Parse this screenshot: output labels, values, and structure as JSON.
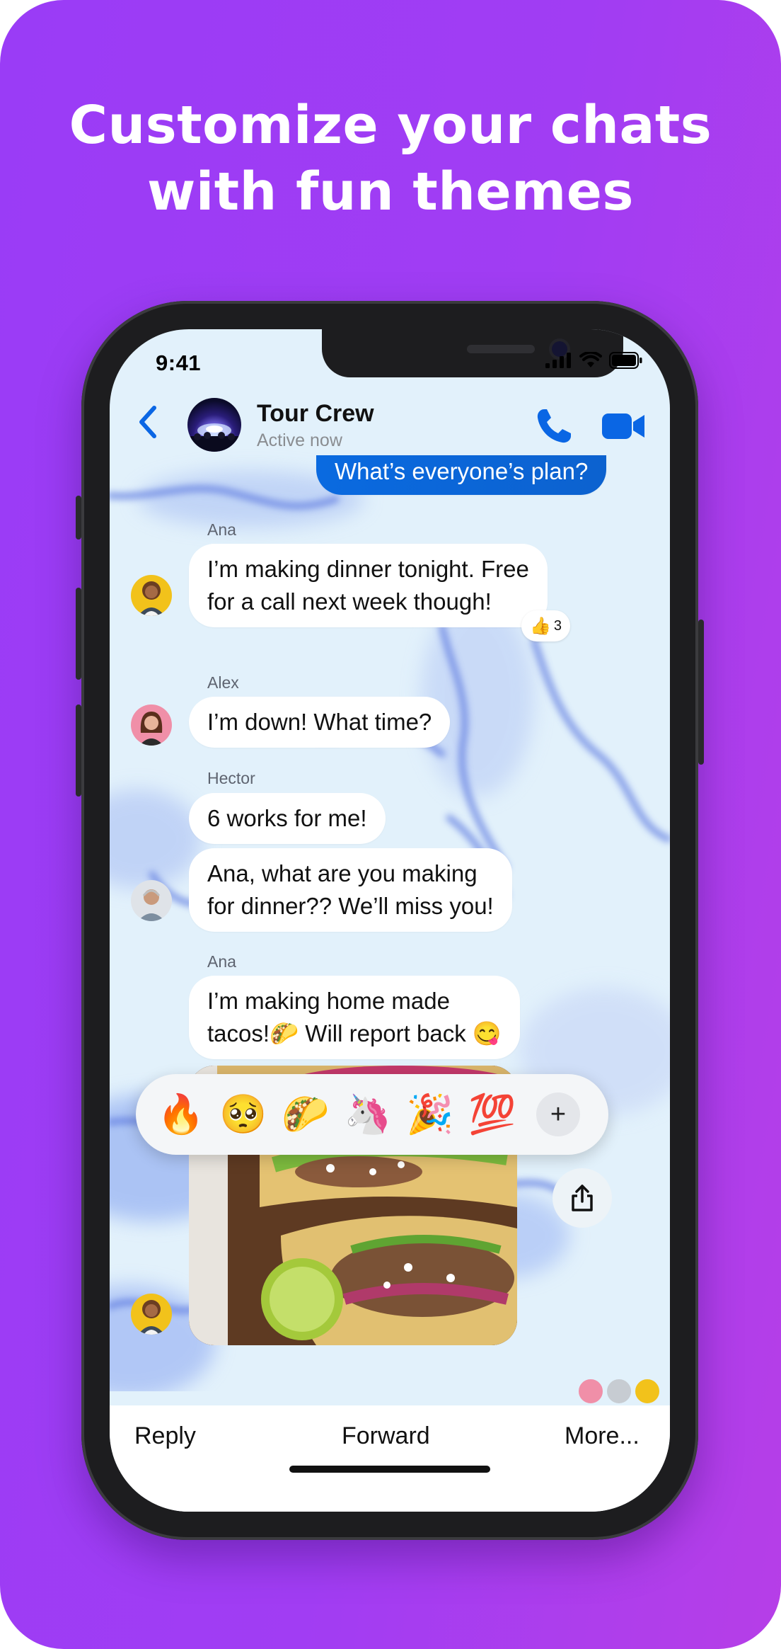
{
  "headline": {
    "line1": "Customize your chats",
    "line2": "with fun themes"
  },
  "status_bar": {
    "time": "9:41"
  },
  "header": {
    "title": "Tour Crew",
    "subtitle": "Active now"
  },
  "messages": {
    "mine_partial": "What’s everyone’s plan?",
    "ana1_sender": "Ana",
    "ana1_line1": "I’m making dinner tonight. Free",
    "ana1_line2": "for a call next week though!",
    "reaction_emoji": "👍",
    "reaction_count": "3",
    "alex_sender": "Alex",
    "alex_text": "I’m down! What time?",
    "hector_sender": "Hector",
    "hector_text1": "6 works for me!",
    "hector_text2_line1": "Ana, what are you making",
    "hector_text2_line2": "for dinner?? We’ll miss you!",
    "ana2_sender": "Ana",
    "ana2_line1": "I’m making home made",
    "ana2_line2": "tacos!🌮 Will report back 😋"
  },
  "reaction_bar": {
    "emojis": [
      "🔥",
      "🥺",
      "🌮",
      "🦄",
      "🎉",
      "💯"
    ],
    "more": "+"
  },
  "bottom_actions": {
    "reply": "Reply",
    "forward": "Forward",
    "more": "More..."
  },
  "colors": {
    "background_start": "#9a3cf6",
    "background_end": "#b63ee7",
    "accent": "#0a6ae0",
    "chat_bg": "#e2f1fb"
  }
}
